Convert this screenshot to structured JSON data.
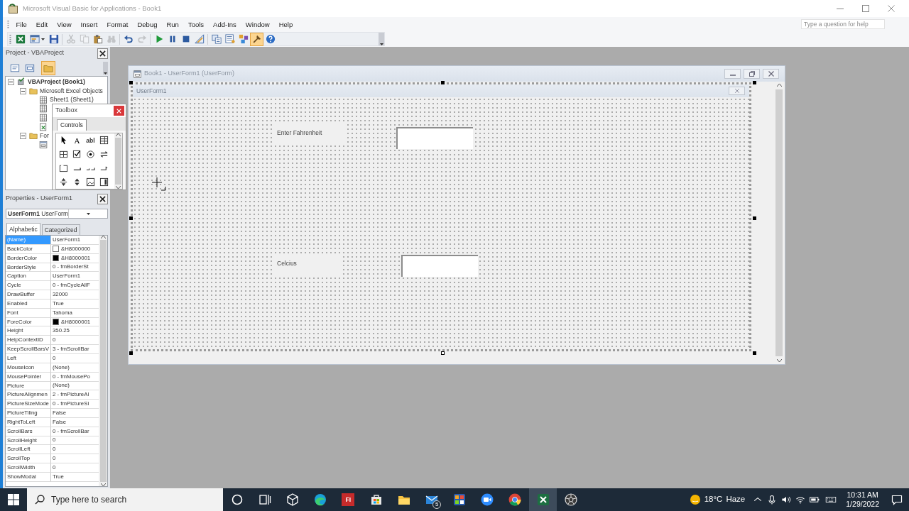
{
  "window": {
    "title": "Microsoft Visual Basic for Applications - Book1"
  },
  "menu": [
    "File",
    "Edit",
    "View",
    "Insert",
    "Format",
    "Debug",
    "Run",
    "Tools",
    "Add-Ins",
    "Window",
    "Help"
  ],
  "help_box": {
    "placeholder": "Type a question for help"
  },
  "toolbar": [
    [
      {
        "kind": "excel",
        "pressed": false,
        "disabled": false
      },
      {
        "kind": "insert-userform",
        "pressed": false,
        "disabled": false
      },
      {
        "kind": "save",
        "pressed": false,
        "disabled": false
      }
    ],
    [
      {
        "kind": "cut",
        "pressed": false,
        "disabled": true
      },
      {
        "kind": "copy",
        "pressed": false,
        "disabled": true
      },
      {
        "kind": "paste",
        "pressed": false,
        "disabled": false
      },
      {
        "kind": "find",
        "pressed": false,
        "disabled": true
      }
    ],
    [
      {
        "kind": "undo",
        "pressed": false,
        "disabled": false
      },
      {
        "kind": "redo",
        "pressed": false,
        "disabled": true
      }
    ],
    [
      {
        "kind": "run",
        "pressed": false,
        "disabled": false
      },
      {
        "kind": "break",
        "pressed": false,
        "disabled": false
      },
      {
        "kind": "reset",
        "pressed": false,
        "disabled": false
      },
      {
        "kind": "design-mode",
        "pressed": false,
        "disabled": false
      }
    ],
    [
      {
        "kind": "project-explorer",
        "pressed": false,
        "disabled": false
      },
      {
        "kind": "properties",
        "pressed": false,
        "disabled": false
      },
      {
        "kind": "object-browser",
        "pressed": false,
        "disabled": false
      },
      {
        "kind": "toolbox",
        "pressed": true,
        "disabled": false
      },
      {
        "kind": "help",
        "pressed": false,
        "disabled": false
      }
    ]
  ],
  "project": {
    "title": "Project - VBAProject",
    "buttons": [
      {
        "kind": "view-code",
        "pressed": false
      },
      {
        "kind": "view-object",
        "pressed": false
      },
      {
        "kind": "toggle-folders",
        "pressed": true
      }
    ],
    "tree": [
      {
        "kind": "project",
        "label": "VBAProject (Book1)",
        "expanded": true,
        "children": [
          {
            "kind": "folder",
            "label": "Microsoft Excel Objects",
            "expanded": true,
            "children": [
              {
                "kind": "sheet",
                "label": "Sheet1 (Sheet1)"
              },
              {
                "kind": "sheet"
              },
              {
                "kind": "sheet"
              },
              {
                "kind": "workbook"
              }
            ]
          },
          {
            "kind": "folder",
            "label": "For",
            "expanded": true,
            "children": [
              {
                "kind": "form"
              }
            ]
          }
        ]
      }
    ]
  },
  "toolbox": {
    "title": "Toolbox",
    "tabs": [
      {
        "label": "Controls",
        "selected": true
      }
    ],
    "controls": [
      {
        "kind": "pointer"
      },
      {
        "kind": "label",
        "glyph": "A"
      },
      {
        "kind": "textbox",
        "glyph": "abl"
      },
      {
        "kind": "combobox"
      },
      {
        "kind": "listbox"
      },
      {
        "kind": "checkbox"
      },
      {
        "kind": "optionbutton"
      },
      {
        "kind": "togglebutton"
      },
      {
        "kind": "frame"
      },
      {
        "kind": "commandbutton"
      },
      {
        "kind": "tabstrip"
      },
      {
        "kind": "multipage"
      },
      {
        "kind": "scrollbar"
      },
      {
        "kind": "spinbutton"
      },
      {
        "kind": "image"
      },
      {
        "kind": "refedit"
      }
    ]
  },
  "properties": {
    "title": "Properties - UserForm1",
    "object": "**UserForm1** UserForm",
    "tabs": [
      {
        "label": "Alphabetic",
        "selected": true
      },
      {
        "label": "Categorized",
        "selected": false
      }
    ],
    "rows": [
      {
        "name": "(Name)",
        "value": "UserForm1",
        "selected": true
      },
      {
        "name": "BackColor",
        "value": "&H8000000",
        "color": "#ffffff",
        "selected": false
      },
      {
        "name": "BorderColor",
        "value": "&H8000001",
        "color": "#000000",
        "selected": false
      },
      {
        "name": "BorderStyle",
        "value": "0 - fmBorderSt",
        "selected": false
      },
      {
        "name": "Caption",
        "value": "UserForm1",
        "selected": false
      },
      {
        "name": "Cycle",
        "value": "0 - fmCycleAllF",
        "selected": false
      },
      {
        "name": "DrawBuffer",
        "value": "32000",
        "selected": false
      },
      {
        "name": "Enabled",
        "value": "True",
        "selected": false
      },
      {
        "name": "Font",
        "value": "Tahoma",
        "selected": false
      },
      {
        "name": "ForeColor",
        "value": "&H8000001",
        "color": "#000000",
        "selected": false
      },
      {
        "name": "Height",
        "value": "350.25",
        "selected": false
      },
      {
        "name": "HelpContextID",
        "value": "0",
        "selected": false
      },
      {
        "name": "KeepScrollBarsV",
        "value": "3 - fmScrollBar",
        "selected": false
      },
      {
        "name": "Left",
        "value": "0",
        "selected": false
      },
      {
        "name": "MouseIcon",
        "value": "(None)",
        "selected": false
      },
      {
        "name": "MousePointer",
        "value": "0 - fmMousePo",
        "selected": false
      },
      {
        "name": "Picture",
        "value": "(None)",
        "selected": false
      },
      {
        "name": "PictureAlignmen",
        "value": "2 - fmPictureAl",
        "selected": false
      },
      {
        "name": "PictureSizeMode",
        "value": "0 - fmPictureSi",
        "selected": false
      },
      {
        "name": "PictureTiling",
        "value": "False",
        "selected": false
      },
      {
        "name": "RightToLeft",
        "value": "False",
        "selected": false
      },
      {
        "name": "ScrollBars",
        "value": "0 - fmScrollBar",
        "selected": false
      },
      {
        "name": "ScrollHeight",
        "value": "0",
        "selected": false
      },
      {
        "name": "ScrollLeft",
        "value": "0",
        "selected": false
      },
      {
        "name": "ScrollTop",
        "value": "0",
        "selected": false
      },
      {
        "name": "ScrollWidth",
        "value": "0",
        "selected": false
      },
      {
        "name": "ShowModal",
        "value": "True",
        "selected": false
      }
    ]
  },
  "designer": {
    "title": "Book1 - UserForm1 (UserForm)",
    "form": {
      "caption": "UserForm1",
      "selected": true,
      "controls": [
        {
          "kind": "label",
          "text": "Enter Fahrenheit"
        },
        {
          "kind": "textbox"
        },
        {
          "kind": "label",
          "text": "Celcius"
        },
        {
          "kind": "textbox"
        }
      ]
    }
  },
  "taskbar": {
    "search": {
      "placeholder": "Type here to search"
    },
    "apps": [
      {
        "kind": "cortana",
        "active": false
      },
      {
        "kind": "task-view",
        "active": false
      },
      {
        "kind": "cube",
        "active": false
      },
      {
        "kind": "edge",
        "active": false
      },
      {
        "kind": "tile",
        "label": "FI",
        "active": false
      },
      {
        "kind": "store",
        "active": false
      },
      {
        "kind": "explorer",
        "active": false
      },
      {
        "kind": "mail",
        "badge": "5",
        "active": false
      },
      {
        "kind": "grid-tile",
        "active": false
      },
      {
        "kind": "video",
        "active": false
      },
      {
        "kind": "chrome",
        "active": false
      },
      {
        "kind": "excel",
        "active": true
      },
      {
        "kind": "aperture",
        "active": false
      }
    ],
    "weather": {
      "temperature": "18°C",
      "condition": "Haze"
    },
    "clock": {
      "time": "10:31 AM",
      "date": "1/29/2022"
    }
  }
}
